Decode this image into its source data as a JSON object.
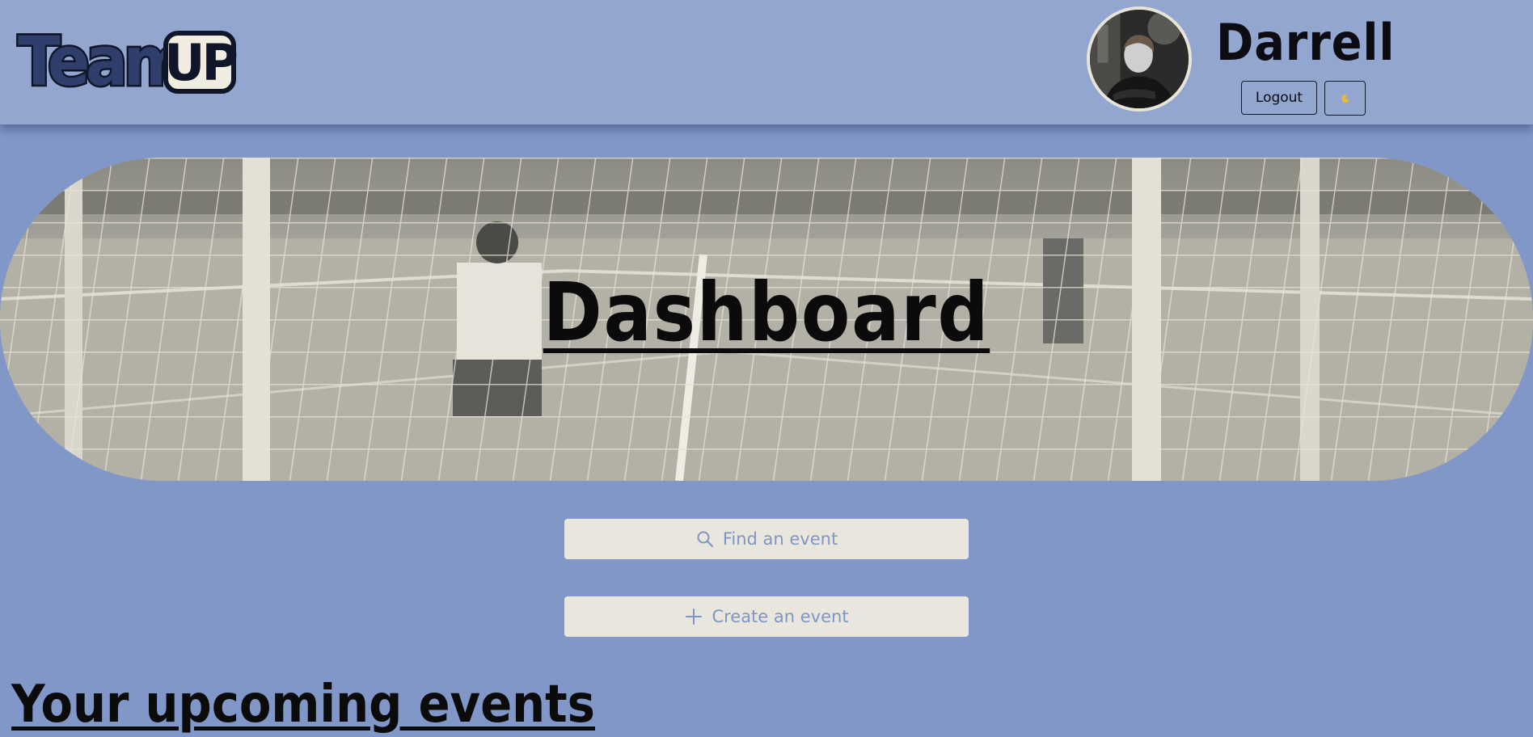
{
  "header": {
    "logo": {
      "text_team": "Team",
      "text_up": "UP"
    },
    "user": {
      "name": "Darrell"
    },
    "logout_label": "Logout",
    "theme_icon": "moon-icon"
  },
  "hero": {
    "title": "Dashboard",
    "background": "soccer-goal-net-photo"
  },
  "actions": {
    "find": {
      "label": "Find an event",
      "icon": "search-icon"
    },
    "create": {
      "label": "Create an event",
      "icon": "plus-icon"
    }
  },
  "upcoming": {
    "heading": "Your upcoming events"
  },
  "colors": {
    "page_bg": "#8197c8",
    "header_bg": "#93a6d0",
    "button_bg": "#e9e6dd",
    "button_text": "#7f95c4",
    "heading_text": "#0b0b0b",
    "moon": "#e8b93a"
  }
}
